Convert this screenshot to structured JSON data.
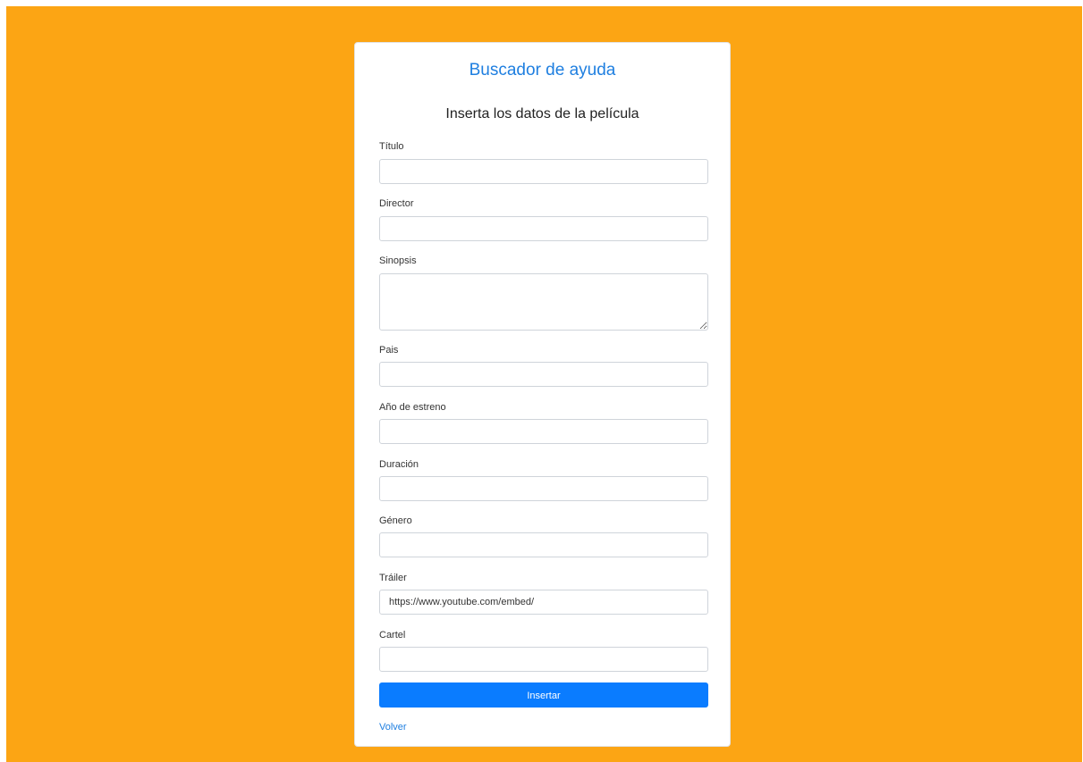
{
  "header": {
    "brand": "Buscador de ayuda",
    "subtitle": "Inserta los datos de la película"
  },
  "form": {
    "fields": [
      {
        "label": "Título",
        "value": ""
      },
      {
        "label": "Director",
        "value": ""
      },
      {
        "label": "Sinopsis",
        "value": ""
      },
      {
        "label": "Pais",
        "value": ""
      },
      {
        "label": "Año de estreno",
        "value": ""
      },
      {
        "label": "Duración",
        "value": ""
      },
      {
        "label": "Género",
        "value": ""
      },
      {
        "label": "Tráiler",
        "value": "https://www.youtube.com/embed/"
      },
      {
        "label": "Cartel",
        "value": ""
      }
    ],
    "submit_label": "Insertar",
    "back_label": "Volver"
  },
  "colors": {
    "background": "#fca514",
    "accent": "#0a7cff",
    "link": "#1f7fe0"
  }
}
